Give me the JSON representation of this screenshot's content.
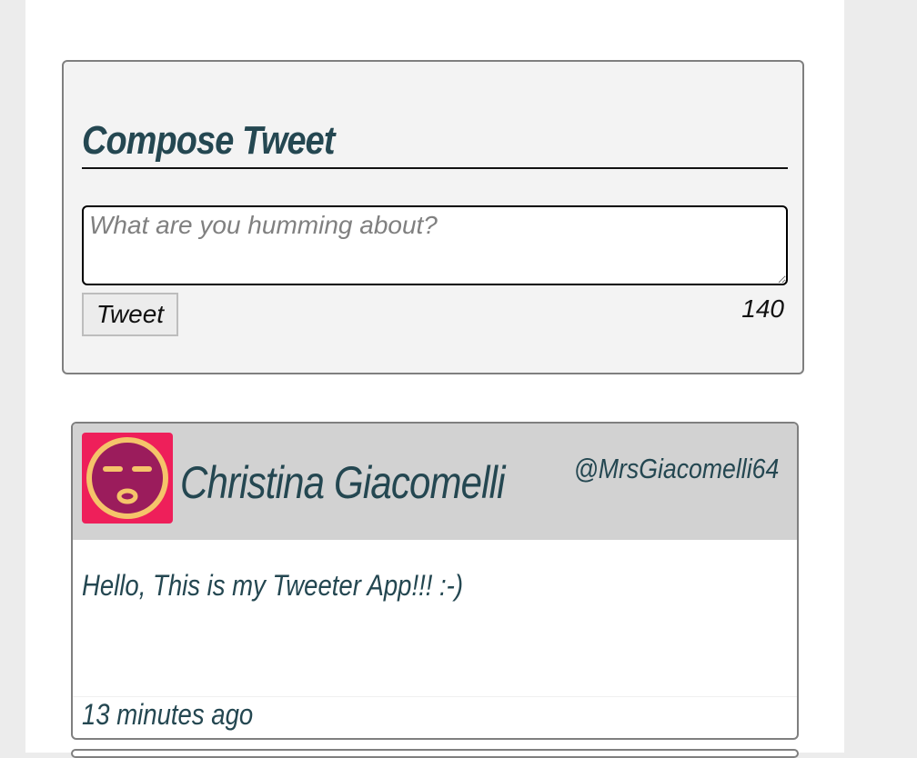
{
  "compose": {
    "title": "Compose Tweet",
    "placeholder": "What are you humming about?",
    "button_label": "Tweet",
    "char_counter": "140"
  },
  "tweets": [
    {
      "avatar_icon": "sleepy-face-icon",
      "user_name": "Christina Giacomelli",
      "handle": "@MrsGiacomelli64",
      "content": "Hello, This is my Tweeter App!!! :-)",
      "timestamp": "13 minutes ago"
    }
  ],
  "colors": {
    "heading": "#244751",
    "avatar_bg": "#ee1f5a",
    "avatar_face": "#9b1c5c",
    "avatar_ring": "#f5c46a"
  }
}
